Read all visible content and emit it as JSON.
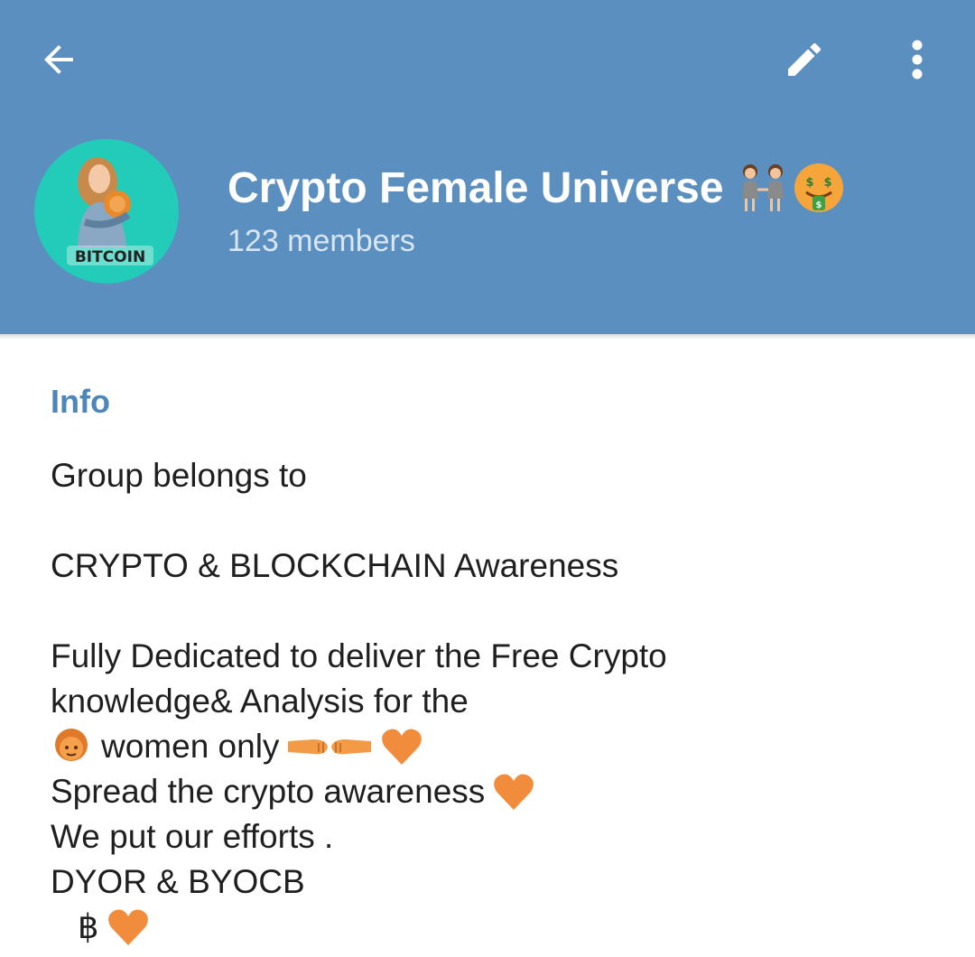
{
  "toolbar": {
    "back_icon": "arrow-left-icon",
    "edit_icon": "pencil-icon",
    "menu_icon": "more-vertical-icon"
  },
  "group": {
    "title": "Crypto Female Universe",
    "members": "123 members",
    "avatar_text": "BITCOIN",
    "title_emojis": [
      "women-holding-hands-emoji",
      "money-mouth-face-emoji"
    ]
  },
  "info": {
    "label": "Info",
    "lines": [
      "Group belongs to",
      "",
      "CRYPTO  & BLOCKCHAIN Awareness",
      "",
      "Fully Dedicated to deliver the Free Crypto",
      "knowledge& Analysis for the",
      "women only",
      "Spread the crypto awareness",
      "We put our efforts .",
      "DYOR & BYOCB",
      "฿"
    ]
  },
  "colors": {
    "header": "#5a8fbf",
    "accent": "#4d87ba",
    "avatar_bg": "#22ccb8",
    "heart": "#f08c3c"
  }
}
